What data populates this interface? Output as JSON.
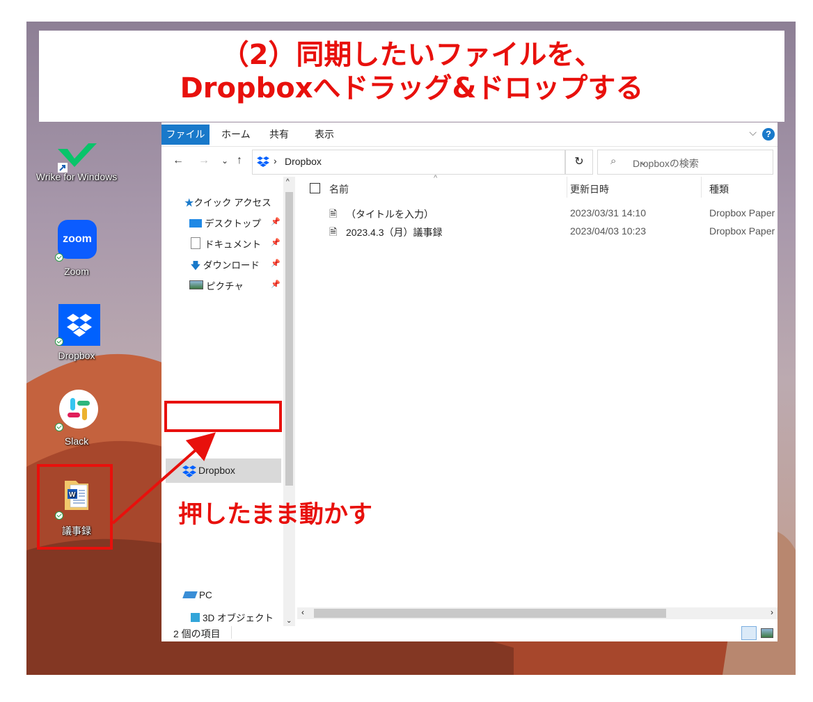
{
  "banner": {
    "line1": "（2）同期したいファイルを、",
    "line2": "Dropboxへドラッグ&ドロップする"
  },
  "desktop_icons": [
    {
      "label": "Wrike for Windows",
      "icon": "wrike-icon"
    },
    {
      "label": "Zoom",
      "icon": "zoom-icon",
      "glyph_text": "zoom"
    },
    {
      "label": "Dropbox",
      "icon": "dropbox-icon"
    },
    {
      "label": "Slack",
      "icon": "slack-icon"
    },
    {
      "label": "議事録",
      "icon": "word-document-icon"
    }
  ],
  "ribbon": {
    "tabs": [
      "ファイル",
      "ホーム",
      "共有",
      "表示"
    ],
    "help": "?"
  },
  "address": {
    "path": "Dropbox",
    "search_placeholder": "Dropboxの検索"
  },
  "nav_pane": {
    "quick_access": "クイック アクセス",
    "items": [
      {
        "label": "デスクトップ",
        "icon": "desktop-folder-icon"
      },
      {
        "label": "ドキュメント",
        "icon": "documents-folder-icon"
      },
      {
        "label": "ダウンロード",
        "icon": "download-icon"
      },
      {
        "label": "ピクチャ",
        "icon": "pictures-folder-icon"
      }
    ],
    "dropbox": "Dropbox",
    "pc": "PC",
    "objects3d": "3D オブジェクト"
  },
  "file_list": {
    "columns": [
      "名前",
      "更新日時",
      "種類"
    ],
    "rows": [
      {
        "name": "（タイトルを入力）",
        "modified": "2023/03/31 14:10",
        "type": "Dropbox Paper"
      },
      {
        "name": "2023.4.3（月）議事録",
        "modified": "2023/04/03 10:23",
        "type": "Dropbox Paper"
      }
    ]
  },
  "status": {
    "count": "2 個の項目"
  },
  "annotation": {
    "caption": "押したまま動かす"
  },
  "colors": {
    "accent_red": "#e8100c",
    "ribbon_blue": "#1979ca",
    "dropbox_blue": "#0061fe"
  }
}
